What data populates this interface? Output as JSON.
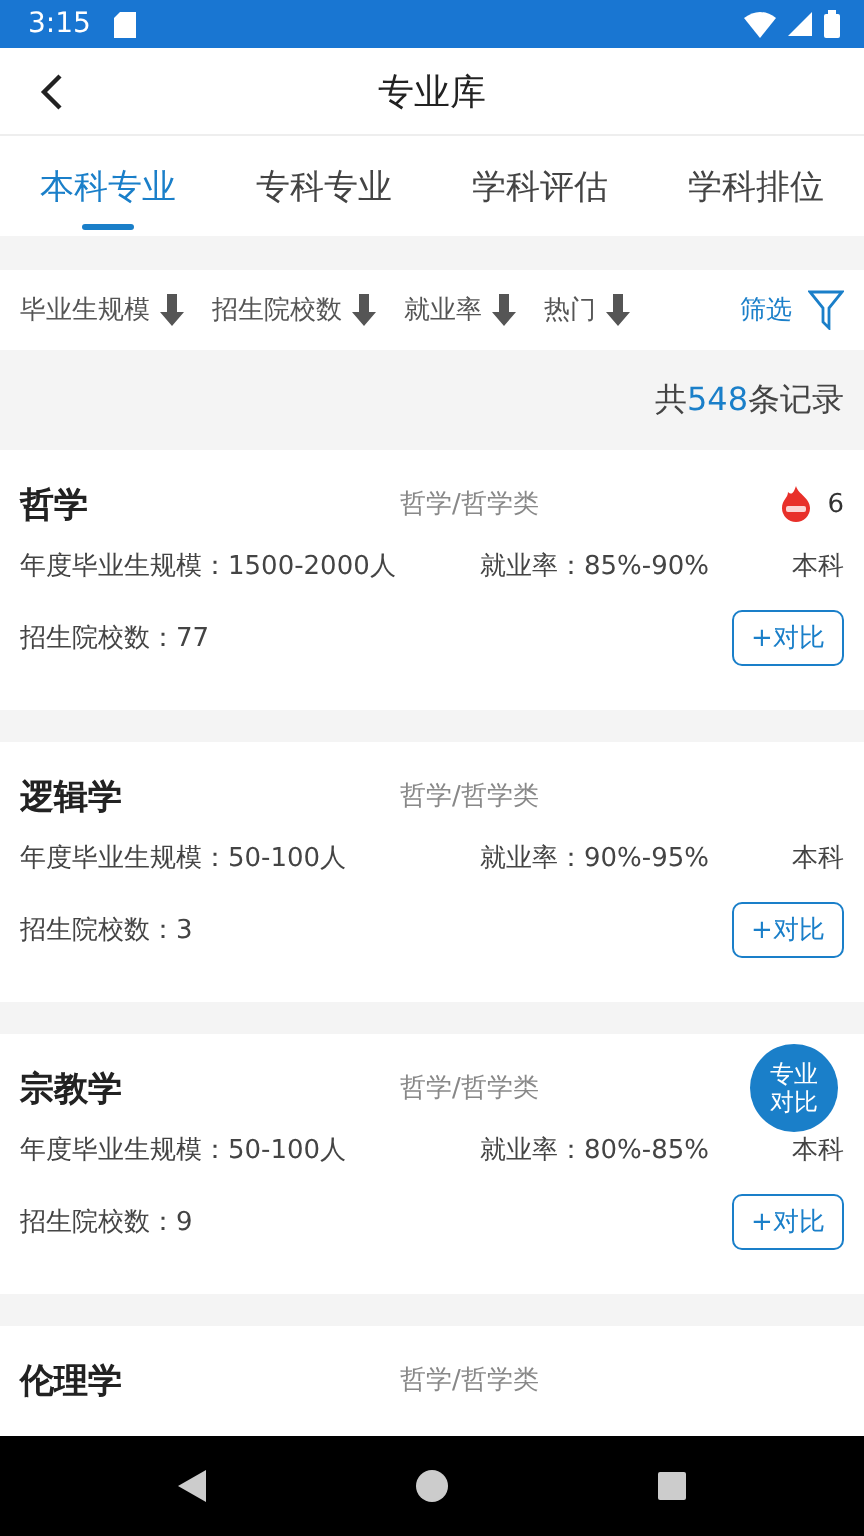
{
  "status_bar": {
    "time": "3:15"
  },
  "header": {
    "title": "专业库"
  },
  "tabs": [
    {
      "label": "本科专业",
      "selected": true
    },
    {
      "label": "专科专业",
      "selected": false
    },
    {
      "label": "学科评估",
      "selected": false
    },
    {
      "label": "学科排位",
      "selected": false
    }
  ],
  "sort_bar": {
    "items": [
      "毕业生规模",
      "招生院校数",
      "就业率",
      "热门"
    ],
    "filter": "筛选"
  },
  "record_count": {
    "prefix": "共",
    "count": "548",
    "suffix": "条记录"
  },
  "majors": [
    {
      "name": "哲学",
      "category": "哲学/哲学类",
      "hot": "6",
      "scale": "年度毕业生规模：1500-2000人",
      "employment": "就业率：85%-90%",
      "level": "本科",
      "schools": "招生院校数：77",
      "compare": "+对比"
    },
    {
      "name": "逻辑学",
      "category": "哲学/哲学类",
      "scale": "年度毕业生规模：50-100人",
      "employment": "就业率：90%-95%",
      "level": "本科",
      "schools": "招生院校数：3",
      "compare": "+对比"
    },
    {
      "name": "宗教学",
      "category": "哲学/哲学类",
      "scale": "年度毕业生规模：50-100人",
      "employment": "就业率：80%-85%",
      "level": "本科",
      "schools": "招生院校数：9",
      "compare": "+对比"
    },
    {
      "name": "伦理学",
      "category": "哲学/哲学类"
    }
  ],
  "floating_button": {
    "line1": "专业",
    "line2": "对比"
  }
}
